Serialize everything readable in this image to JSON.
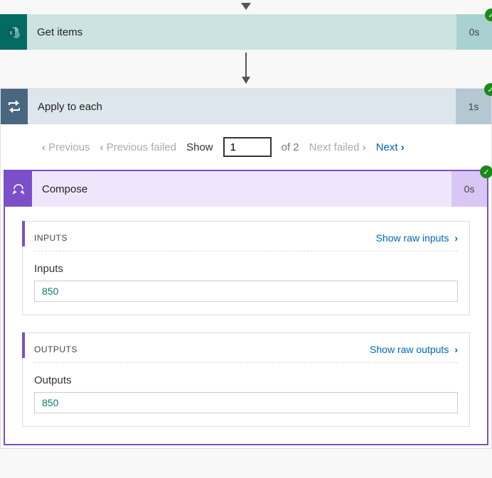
{
  "getItems": {
    "title": "Get items",
    "time": "0s",
    "iconLetter": "s"
  },
  "applyToEach": {
    "title": "Apply to each",
    "time": "1s"
  },
  "pager": {
    "prev": "Previous",
    "prevFailed": "Previous failed",
    "showLabel": "Show",
    "current": "1",
    "ofText": "of 2",
    "nextFailed": "Next failed",
    "next": "Next"
  },
  "compose": {
    "title": "Compose",
    "time": "0s",
    "inputs": {
      "header": "INPUTS",
      "rawLink": "Show raw inputs",
      "fieldLabel": "Inputs",
      "fieldValue": "850"
    },
    "outputs": {
      "header": "OUTPUTS",
      "rawLink": "Show raw outputs",
      "fieldLabel": "Outputs",
      "fieldValue": "850"
    }
  }
}
